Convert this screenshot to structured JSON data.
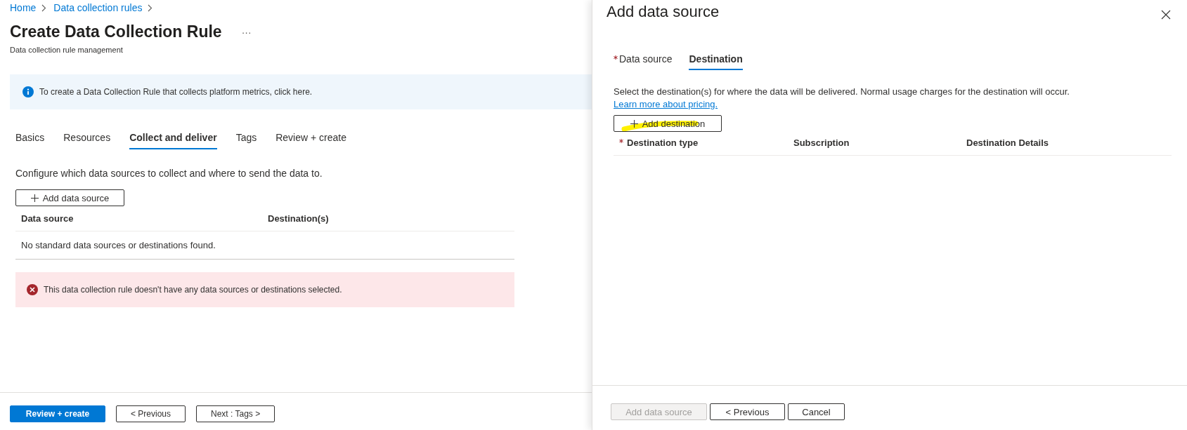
{
  "breadcrumb": [
    {
      "label": "Home"
    },
    {
      "label": "Data collection rules"
    }
  ],
  "page": {
    "title": "Create Data Collection Rule",
    "more": "···",
    "subtitle": "Data collection rule management"
  },
  "info_banner": {
    "text": "To create a Data Collection Rule that collects platform metrics, click here."
  },
  "tabs": [
    {
      "label": "Basics",
      "selected": false
    },
    {
      "label": "Resources",
      "selected": false
    },
    {
      "label": "Collect and deliver",
      "selected": true
    },
    {
      "label": "Tags",
      "selected": false
    },
    {
      "label": "Review + create",
      "selected": false
    }
  ],
  "description": "Configure which data sources to collect and where to send the data to.",
  "add_button": {
    "label": "Add data source"
  },
  "table": {
    "columns": [
      "Data source",
      "Destination(s)"
    ],
    "empty_message": "No standard data sources or destinations found."
  },
  "error_banner": {
    "text": "This data collection rule doesn't have any data sources or destinations selected."
  },
  "footer_buttons": [
    {
      "label": "Review + create",
      "kind": "primary"
    },
    {
      "label": "< Previous",
      "kind": "default"
    },
    {
      "label": "Next : Tags >",
      "kind": "default"
    }
  ],
  "panel": {
    "title": "Add data source",
    "tabs": [
      {
        "label": "Data source",
        "required": true,
        "selected": false
      },
      {
        "label": "Destination",
        "required": false,
        "selected": true
      }
    ],
    "description": "Select the destination(s) for where the data will be delivered. Normal usage charges for the destination will occur.",
    "link": "Learn more about pricing.",
    "add_button": {
      "label": "Add destination"
    },
    "columns": [
      {
        "label": "Destination type",
        "required": true
      },
      {
        "label": "Subscription",
        "required": false
      },
      {
        "label": "Destination Details",
        "required": false
      }
    ],
    "footer_buttons": [
      {
        "label": "Add data source",
        "kind": "disabled"
      },
      {
        "label": "< Previous",
        "kind": "default"
      },
      {
        "label": "Cancel",
        "kind": "default"
      }
    ]
  }
}
